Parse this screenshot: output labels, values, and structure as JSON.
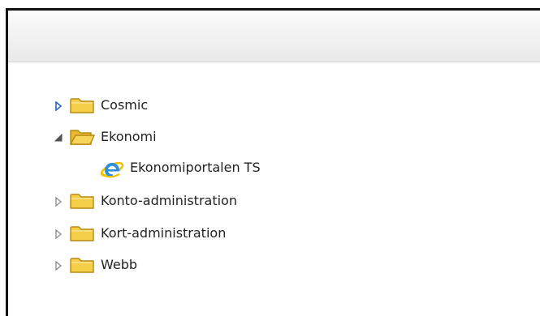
{
  "tree": {
    "items": [
      {
        "label": "Cosmic",
        "expanded": false,
        "toggle_icon": "expand-arrow-icon",
        "icon": "folder-icon"
      },
      {
        "label": "Ekonomi",
        "expanded": true,
        "toggle_icon": "collapse-arrow-icon",
        "icon": "folder-open-icon",
        "children": [
          {
            "label": "Ekonomiportalen TS",
            "icon": "internet-explorer-icon"
          }
        ]
      },
      {
        "label": "Konto-administration",
        "expanded": false,
        "toggle_icon": "expand-arrow-icon",
        "icon": "folder-icon"
      },
      {
        "label": "Kort-administration",
        "expanded": false,
        "toggle_icon": "expand-arrow-icon",
        "icon": "folder-icon"
      },
      {
        "label": "Webb",
        "expanded": false,
        "toggle_icon": "expand-arrow-icon",
        "icon": "folder-icon"
      }
    ]
  },
  "colors": {
    "active_toggle": "#2a63c7",
    "inactive_toggle": "#8a8a8a",
    "folder_fill": "#f5cf47",
    "folder_stroke": "#b68a14",
    "header_bg": "#f1f1f1",
    "window_border": "#111111"
  }
}
